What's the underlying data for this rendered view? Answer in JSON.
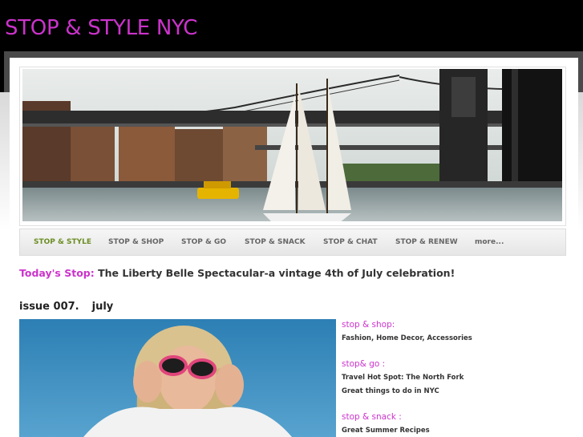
{
  "colors": {
    "accent": "#cc33cc",
    "nav_active": "#6b8e23",
    "nav_text": "#666666"
  },
  "header": {
    "site_title": "STOP & STYLE NYC"
  },
  "banner": {
    "image": "brooklyn-bridge-sailboat-photo"
  },
  "nav": {
    "items": [
      {
        "label": "STOP & STYLE",
        "active": true
      },
      {
        "label": "STOP & SHOP"
      },
      {
        "label": "STOP & GO"
      },
      {
        "label": "STOP & SNACK"
      },
      {
        "label": "STOP & CHAT"
      },
      {
        "label": "STOP & RENEW"
      },
      {
        "label": "more..."
      }
    ]
  },
  "todays_stop": {
    "label": "Today's Stop:",
    "text": "The Liberty Belle Spectacular-a vintage 4th of July celebration!"
  },
  "issue": {
    "number": "issue 007.",
    "month": "july"
  },
  "feature": {
    "image": "woman-pink-sunglasses-photo"
  },
  "sidebar": {
    "sections": [
      {
        "heading": "stop & shop:",
        "links": [
          "Fashion, Home Decor, Accessories"
        ]
      },
      {
        "heading": "stop& go :",
        "links": [
          "Travel Hot Spot: The North Fork",
          "Great things to do in NYC"
        ]
      },
      {
        "heading": "stop & snack :",
        "links": [
          "Great Summer Recipes"
        ]
      }
    ]
  }
}
